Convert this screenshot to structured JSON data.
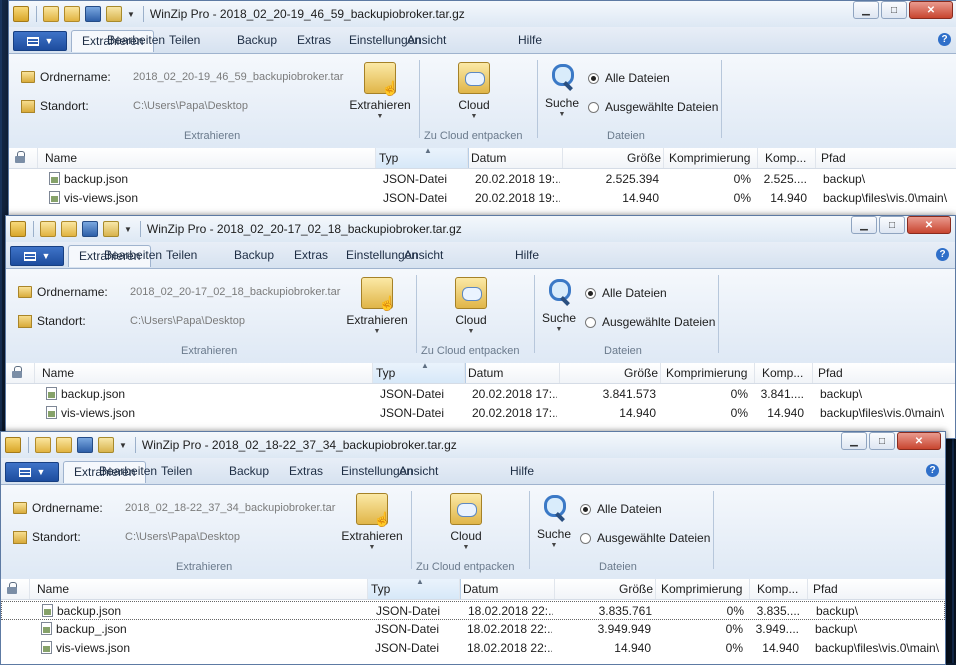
{
  "icons": {
    "app": "winzip-app-icon",
    "open": "open-folder-icon",
    "save": "save-icon",
    "unzip": "extract-icon",
    "help": "help-icon"
  },
  "colors": {
    "accent": "#1d4d9e",
    "ribbon": "#dfe9f5",
    "close": "#c8452f"
  },
  "labels": {
    "tabs": [
      "Extrahieren",
      "Bearbeiten",
      "Teilen",
      "Backup",
      "Extras",
      "Einstellungen",
      "Ansicht",
      "Hilfe"
    ],
    "ordnername": "Ordnername:",
    "standort": "Standort:",
    "extrahieren_btn": "Extrahieren",
    "cloud_btn": "Cloud",
    "suche_btn": "Suche",
    "alle_dateien": "Alle Dateien",
    "ausgewaehlte": "Ausgewählte Dateien",
    "group_extract": "Extrahieren",
    "group_cloud": "Zu Cloud entpacken",
    "group_files": "Dateien",
    "columns": {
      "name": "Name",
      "typ": "Typ",
      "datum": "Datum",
      "groesse": "Größe",
      "kompr": "Komprimierung",
      "komp": "Komp...",
      "pfad": "Pfad"
    },
    "help": "?"
  },
  "windows": [
    {
      "title": "WinZip Pro - 2018_02_20-19_46_59_backupiobroker.tar.gz",
      "ordner": "2018_02_20-19_46_59_backupiobroker.tar",
      "standort": "C:\\Users\\Papa\\Desktop",
      "rows": [
        {
          "name": "backup.json",
          "typ": "JSON-Datei",
          "datum": "20.02.2018 19:...",
          "groesse": "2.525.394",
          "kompr": "0%",
          "komp": "2.525....",
          "pfad": "backup\\"
        },
        {
          "name": "vis-views.json",
          "typ": "JSON-Datei",
          "datum": "20.02.2018 19:...",
          "groesse": "14.940",
          "kompr": "0%",
          "komp": "14.940",
          "pfad": "backup\\files\\vis.0\\main\\"
        }
      ]
    },
    {
      "title": "WinZip Pro - 2018_02_20-17_02_18_backupiobroker.tar.gz",
      "ordner": "2018_02_20-17_02_18_backupiobroker.tar",
      "standort": "C:\\Users\\Papa\\Desktop",
      "rows": [
        {
          "name": "backup.json",
          "typ": "JSON-Datei",
          "datum": "20.02.2018 17:...",
          "groesse": "3.841.573",
          "kompr": "0%",
          "komp": "3.841....",
          "pfad": "backup\\"
        },
        {
          "name": "vis-views.json",
          "typ": "JSON-Datei",
          "datum": "20.02.2018 17:...",
          "groesse": "14.940",
          "kompr": "0%",
          "komp": "14.940",
          "pfad": "backup\\files\\vis.0\\main\\"
        }
      ]
    },
    {
      "title": "WinZip Pro - 2018_02_18-22_37_34_backupiobroker.tar.gz",
      "ordner": "2018_02_18-22_37_34_backupiobroker.tar",
      "standort": "C:\\Users\\Papa\\Desktop",
      "rows": [
        {
          "name": "backup.json",
          "typ": "JSON-Datei",
          "datum": "18.02.2018 22:...",
          "groesse": "3.835.761",
          "kompr": "0%",
          "komp": "3.835....",
          "pfad": "backup\\"
        },
        {
          "name": "backup_.json",
          "typ": "JSON-Datei",
          "datum": "18.02.2018 22:...",
          "groesse": "3.949.949",
          "kompr": "0%",
          "komp": "3.949....",
          "pfad": "backup\\"
        },
        {
          "name": "vis-views.json",
          "typ": "JSON-Datei",
          "datum": "18.02.2018 22:...",
          "groesse": "14.940",
          "kompr": "0%",
          "komp": "14.940",
          "pfad": "backup\\files\\vis.0\\main\\"
        }
      ]
    }
  ]
}
